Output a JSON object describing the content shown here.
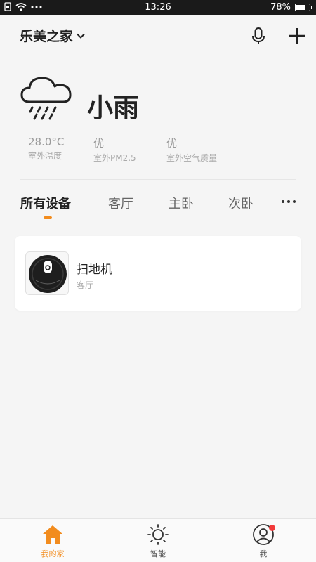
{
  "status_bar": {
    "time": "13:26",
    "battery": "78%",
    "battery_level": 0.78
  },
  "header": {
    "home_name": "乐美之家",
    "icons": [
      "chevron-down-icon",
      "microphone-icon",
      "plus-icon"
    ]
  },
  "weather": {
    "condition": "小雨",
    "icon": "rain-cloud-icon",
    "stats": [
      {
        "value": "28.0°C",
        "label": "室外温度"
      },
      {
        "value": "优",
        "label": "室外PM2.5"
      },
      {
        "value": "优",
        "label": "室外空气质量"
      }
    ]
  },
  "tabs": {
    "items": [
      "所有设备",
      "客厅",
      "主卧",
      "次卧"
    ],
    "active_index": 0,
    "accent_color": "#f28c1e"
  },
  "devices": [
    {
      "name": "扫地机",
      "room": "客厅",
      "icon": "robot-vacuum-icon"
    }
  ],
  "bottom_nav": {
    "items": [
      {
        "label": "我的家",
        "icon": "home-icon",
        "active": true
      },
      {
        "label": "智能",
        "icon": "sun-icon",
        "active": false
      },
      {
        "label": "我",
        "icon": "user-profile-icon",
        "active": false,
        "badge": true
      }
    ],
    "badge_color": "#f23a3a"
  }
}
